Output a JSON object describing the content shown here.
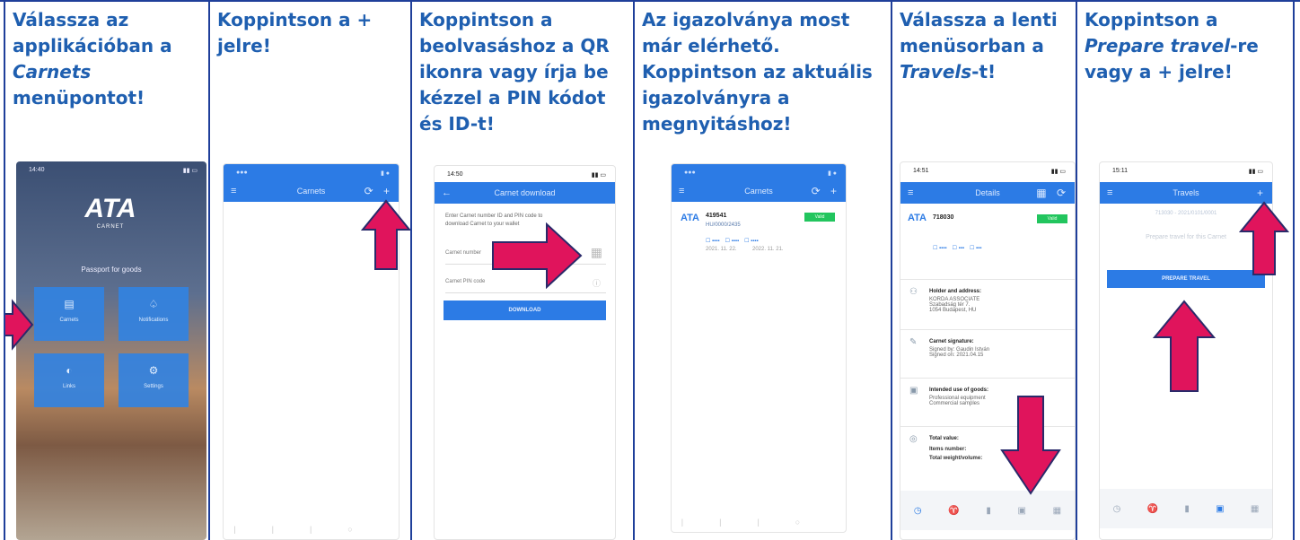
{
  "panels": [
    {
      "instruction_html": "Válassza az applikációban a <i>Carnets</i> menüpontot!",
      "phone": {
        "time": "14:40",
        "logo": "ATA",
        "logo_sub": "CARNET",
        "tagline": "Passport for goods",
        "tiles": [
          {
            "icon": "carnets-icon",
            "label": "Carnets"
          },
          {
            "icon": "bell-icon",
            "label": "Notifications"
          },
          {
            "icon": "info-icon",
            "label": "Links"
          },
          {
            "icon": "settings-icon",
            "label": "Settings"
          }
        ]
      }
    },
    {
      "instruction_html": "Koppintson a <i>+</i> jelre!",
      "phone": {
        "title": "Carnets",
        "actions": "⟳ +"
      }
    },
    {
      "instruction_html": "Koppintson a beolvasáshoz a QR ikonra vagy írja be kézzel a PIN kódot és ID-t!",
      "phone": {
        "time": "14:50",
        "title": "Carnet download",
        "help_text": "Enter Carnet number ID and PIN code to download Carnet to your wallet",
        "field1": "Carnet number",
        "field2": "Carnet PIN code",
        "button": "DOWNLOAD"
      }
    },
    {
      "instruction_html": "Az igazolványa most már elérhető. Koppintson az aktuális igazolványra a megnyitáshoz!",
      "phone": {
        "title": "Carnets",
        "actions": "⟳ +",
        "carnet_id": "419541",
        "carnet_sub": "HU/0000/2435",
        "status": "Valid",
        "d1": "2021. 11. 22.",
        "d2": "2022. 11. 21."
      }
    },
    {
      "instruction_html": "Válassza a lenti menüsorban a <i>Travels</i>-t!",
      "phone": {
        "time": "14:51",
        "title": "Details",
        "carnet_id": "718030",
        "status": "Valid",
        "sections": [
          {
            "title": "Holder and address:",
            "lines": [
              "KORDA ASSOCIATE",
              "Szabadság tér 7.",
              "1054 Budapest, HU"
            ]
          },
          {
            "title": "Carnet signature:",
            "lines": [
              "Signed by: Gaudin István",
              "Signed on: 2021.04.15"
            ]
          },
          {
            "title": "Intended use of goods:",
            "lines": [
              "Professional equipment",
              "Commercial samples"
            ]
          },
          {
            "title": "Total value:",
            "lines": [
              "Items number:",
              "Total weight/volume:"
            ]
          }
        ]
      }
    },
    {
      "instruction_html": "Koppintson a <i>Prepare travel</i>-re vagy a <i>+</i> jelre!",
      "phone": {
        "time": "15:11",
        "title": "Travels",
        "subtitle": "713030 - 2021/0101/0001",
        "prompt": "Prepare travel for this Carnet",
        "button": "PREPARE TRAVEL"
      }
    }
  ]
}
